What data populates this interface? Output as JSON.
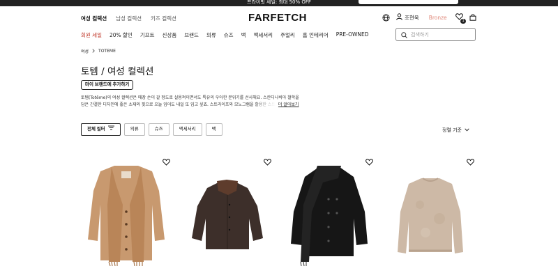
{
  "promo": {
    "text": "프라이빗 세일: 최대 50% OFF"
  },
  "header": {
    "gender_tabs": [
      "여성 컬렉션",
      "남성 컬렉션",
      "키즈 컬렉션"
    ],
    "logo": "FARFETCH",
    "user_name": "조현욱",
    "tier": "Bronze",
    "wishlist_count": "1",
    "icons": {
      "globe": "globe-icon",
      "user": "user-icon",
      "wishlist": "heart-icon",
      "bag": "shopping-bag-icon",
      "search": "search-icon"
    }
  },
  "nav": {
    "categories": [
      "회원 세일",
      "20% 할인",
      "기프트",
      "신상품",
      "브랜드",
      "의류",
      "슈즈",
      "백",
      "액세서리",
      "주얼리",
      "홈 인테리어",
      "PRE-OWNED"
    ]
  },
  "search": {
    "placeholder": "검색하기"
  },
  "breadcrumb": [
    "여성",
    "TOTEME"
  ],
  "page": {
    "title": "토템 / 여성 컬렉션",
    "brand_button": "마이 브랜드에 추가하기",
    "description_line1": "토템(Totême)의 여성 컬렉션은 매장 손이 갈 정도로 실용적이면서도 특유의 우아한 분위기를 선사해요. 스칸디나비아 철학을",
    "description_line2": "담은 간결한 디자인에 좋은 소재와 핏으로 오늘 입어도 내일 또 입고 싶죠. 스트라이프와 모노그램을 활용한 스트",
    "more_link": "더 알아보기"
  },
  "filters": {
    "all_label": "전체 필터",
    "chips": [
      "의류",
      "슈즈",
      "액세서리",
      "백"
    ],
    "sort_label": "정렬 기준"
  },
  "products": [
    {
      "name": "camel-scarf-jacket",
      "wish_icon": "heart-icon"
    },
    {
      "name": "brown-corduroy-collar-jacket",
      "wish_icon": "heart-icon"
    },
    {
      "name": "black-scarf-coat",
      "wish_icon": "heart-icon"
    },
    {
      "name": "beige-mohair-sweater",
      "wish_icon": "heart-icon"
    }
  ],
  "colors": {
    "sale": "#c0392b",
    "tier": "#e08a7c",
    "dark": "#222222"
  }
}
